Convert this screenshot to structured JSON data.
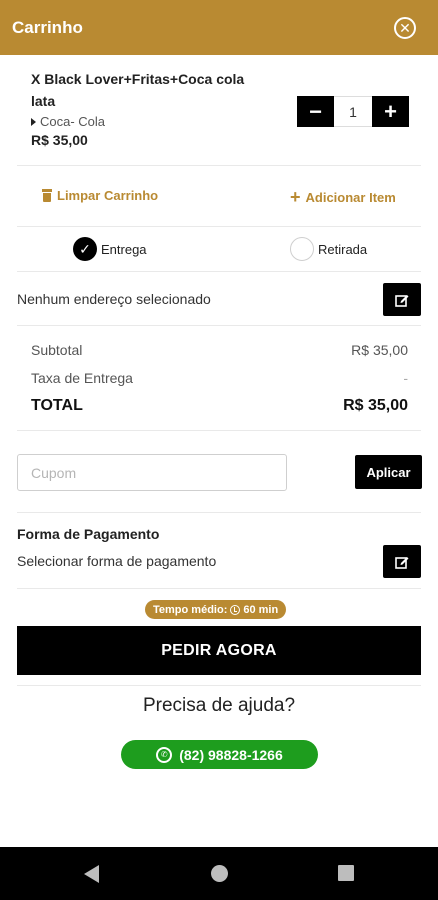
{
  "header": {
    "title": "Carrinho",
    "close_icon": "close-circle-icon"
  },
  "cart_item": {
    "name": "X Black Lover+Fritas+Coca cola lata",
    "option": "Coca- Cola",
    "price": "R$ 35,00",
    "quantity": "1"
  },
  "actions": {
    "clear_label": "Limpar Carrinho",
    "add_label": "Adicionar Item"
  },
  "delivery": {
    "option_delivery": "Entrega",
    "option_pickup": "Retirada",
    "selected": "Entrega"
  },
  "address": {
    "text": "Nenhum endereço selecionado"
  },
  "summary": {
    "subtotal_label": "Subtotal",
    "subtotal_value": "R$ 35,00",
    "fee_label": "Taxa de Entrega",
    "fee_value": "-",
    "total_label": "TOTAL",
    "total_value": "R$ 35,00"
  },
  "coupon": {
    "placeholder": "Cupom",
    "value": "",
    "apply_label": "Aplicar"
  },
  "payment": {
    "title": "Forma de Pagamento",
    "text": "Selecionar forma de pagamento"
  },
  "estimate": {
    "text": "Tempo médio:",
    "value": "60 min"
  },
  "order": {
    "button_label": "PEDIR AGORA"
  },
  "help": {
    "title": "Precisa de ajuda?",
    "whatsapp": "(82) 98828-1266"
  },
  "colors": {
    "brand": "#b98a32",
    "primary_button": "#000000",
    "whatsapp": "#1e9d1e"
  }
}
